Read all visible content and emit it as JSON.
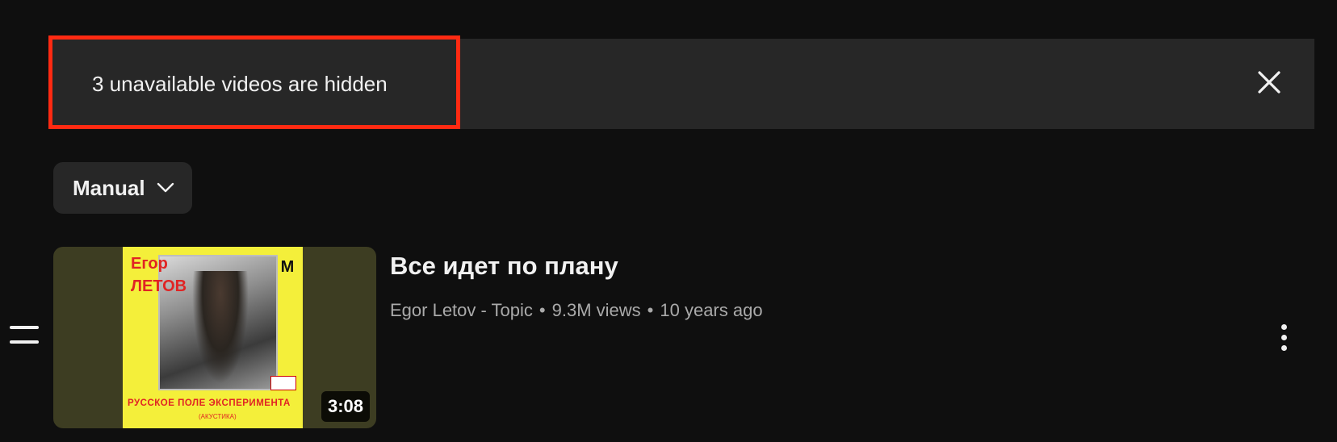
{
  "banner": {
    "message": "3 unavailable videos are hidden",
    "close_icon": "close-icon"
  },
  "sort": {
    "label": "Manual",
    "icon": "chevron-down-icon"
  },
  "video": {
    "title": "Все идет по плану",
    "channel": "Egor Letov - Topic",
    "views": "9.3M views",
    "age": "10 years ago",
    "duration": "3:08",
    "cover": {
      "artist_line1": "Егор",
      "artist_line2": "ЛЕТОВ",
      "logo": "M",
      "album": "РУССКОЕ ПОЛЕ ЭКСПЕРИМЕНТА",
      "album_sub": "(АКУСТИКА)"
    }
  },
  "colors": {
    "background": "#0f0f0f",
    "banner_bg": "#272727",
    "highlight": "#ff2a12",
    "cover_yellow": "#f4ef3a",
    "meta_text": "#aaaaaa"
  }
}
